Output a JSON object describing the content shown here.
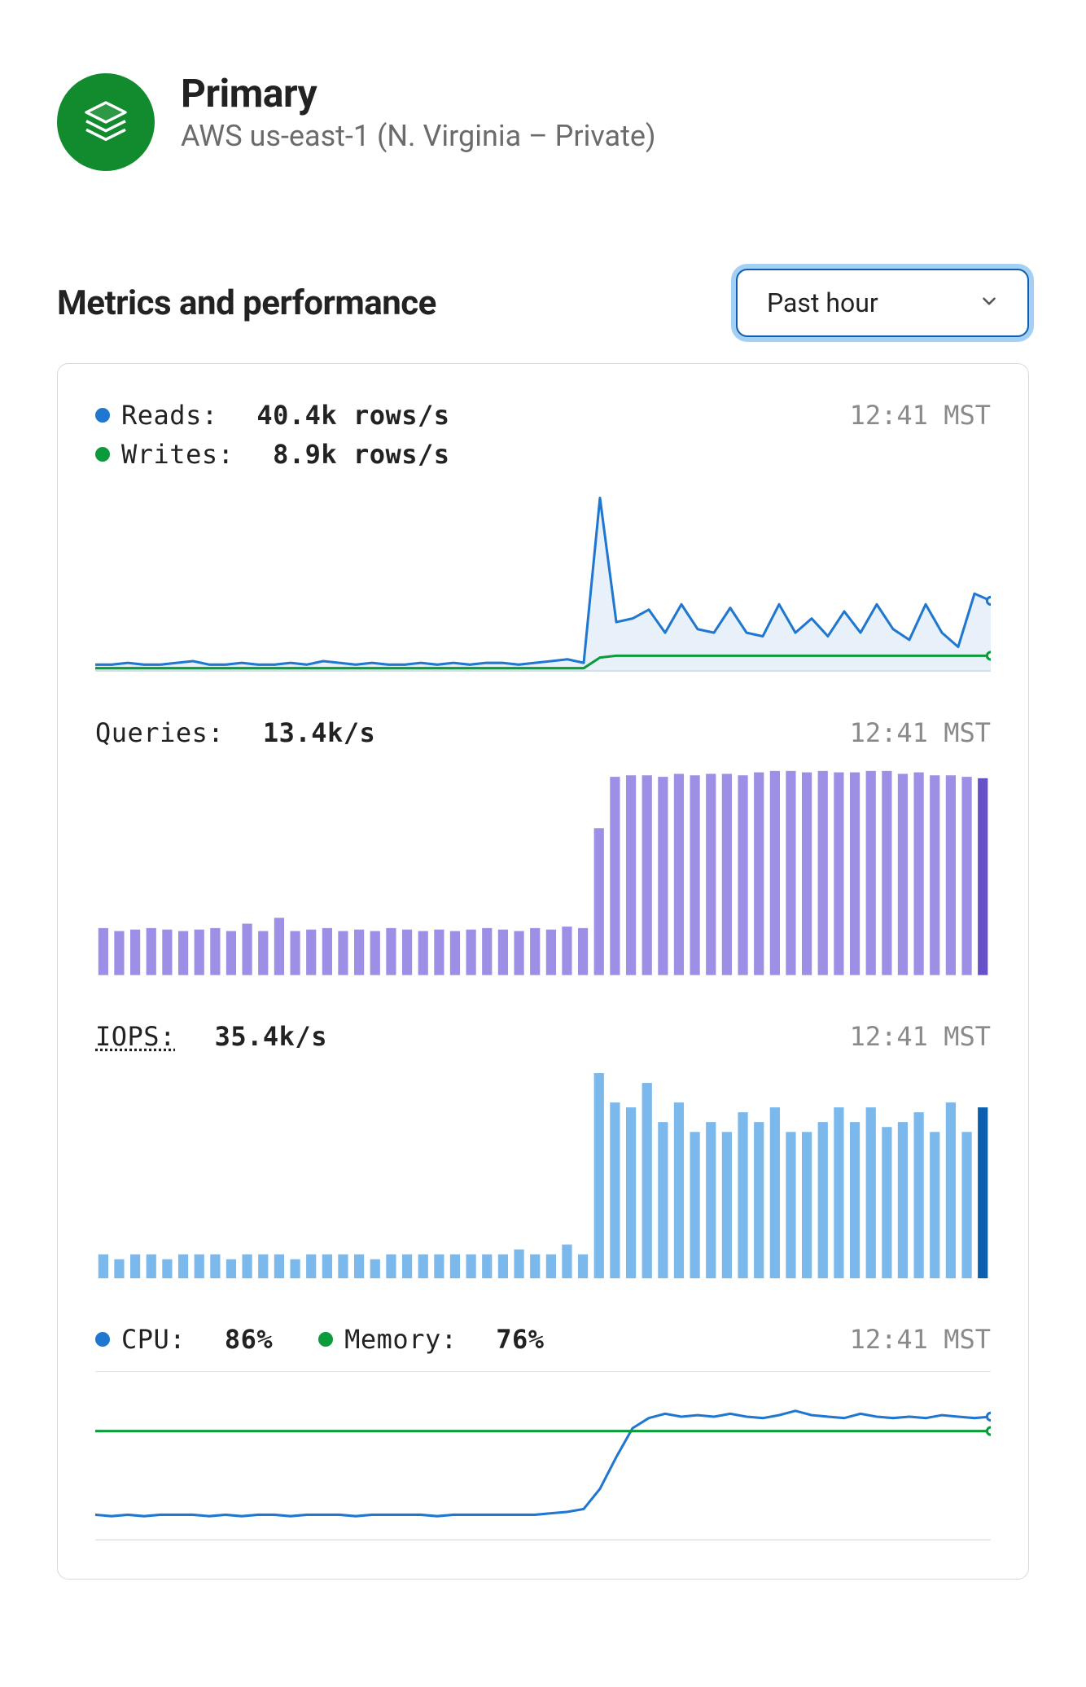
{
  "header": {
    "title": "Primary",
    "subtitle": "AWS us-east-1 (N. Virginia – Private)"
  },
  "section": {
    "title": "Metrics and performance",
    "range_selected": "Past hour"
  },
  "colors": {
    "blue": "#1F77D0",
    "green": "#0B9B3B",
    "purple": "#9E8FE6",
    "purple_dark": "#6651C9",
    "light_blue": "#7BB8EC",
    "blue_dark": "#0B5FAE"
  },
  "plots": {
    "rw": {
      "timestamp": "12:41 MST",
      "reads": {
        "label": "Reads:",
        "value": "40.4k rows/s"
      },
      "writes": {
        "label": "Writes:",
        "value": "8.9k rows/s"
      }
    },
    "queries": {
      "timestamp": "12:41 MST",
      "label": "Queries:",
      "value": "13.4k/s"
    },
    "iops": {
      "timestamp": "12:41 MST",
      "label": "IOPS:",
      "value": "35.4k/s"
    },
    "cpu_mem": {
      "timestamp": "12:41 MST",
      "cpu": {
        "label": "CPU:",
        "value": "86%"
      },
      "memory": {
        "label": "Memory:",
        "value": "76%"
      }
    }
  },
  "chart_data": [
    {
      "type": "line",
      "name": "reads_writes",
      "x_range_minutes": [
        0,
        60
      ],
      "series": [
        {
          "name": "Reads (k rows/s)",
          "values": [
            4,
            4,
            5,
            4,
            4,
            5,
            6,
            4,
            4,
            5,
            4,
            4,
            5,
            4,
            6,
            5,
            4,
            5,
            4,
            4,
            5,
            4,
            5,
            4,
            5,
            5,
            4,
            5,
            6,
            7,
            5,
            98,
            28,
            30,
            35,
            22,
            38,
            24,
            22,
            36,
            22,
            20,
            38,
            22,
            30,
            20,
            34,
            22,
            38,
            24,
            18,
            38,
            22,
            14,
            44,
            40
          ]
        },
        {
          "name": "Writes (k rows/s)",
          "values": [
            2,
            2,
            2,
            2,
            2,
            2,
            2,
            2,
            2,
            2,
            2,
            2,
            2,
            2,
            2,
            2,
            2,
            2,
            2,
            2,
            2,
            2,
            2,
            2,
            2,
            2,
            2,
            2,
            2,
            2,
            2,
            8,
            9,
            9,
            9,
            9,
            9,
            9,
            9,
            9,
            9,
            9,
            9,
            9,
            9,
            9,
            9,
            9,
            9,
            9,
            9,
            9,
            9,
            9,
            9,
            9
          ]
        }
      ],
      "ylim": [
        0,
        100
      ]
    },
    {
      "type": "bar",
      "name": "queries",
      "x_range_minutes": [
        0,
        60
      ],
      "values_ks": [
        3.2,
        3.0,
        3.1,
        3.2,
        3.1,
        3.0,
        3.1,
        3.2,
        3.0,
        3.5,
        3.0,
        3.9,
        3.0,
        3.1,
        3.2,
        3.0,
        3.1,
        3.0,
        3.2,
        3.1,
        3.0,
        3.1,
        3.0,
        3.1,
        3.2,
        3.1,
        3.0,
        3.2,
        3.1,
        3.3,
        3.2,
        10.0,
        13.5,
        13.6,
        13.6,
        13.5,
        13.7,
        13.6,
        13.7,
        13.7,
        13.6,
        13.8,
        13.9,
        13.9,
        13.8,
        13.9,
        13.8,
        13.8,
        13.9,
        13.9,
        13.7,
        13.8,
        13.6,
        13.6,
        13.5,
        13.4
      ],
      "ylim": [
        0,
        14
      ]
    },
    {
      "type": "bar",
      "name": "iops",
      "x_range_minutes": [
        0,
        60
      ],
      "values_ks": [
        5,
        4,
        5,
        5,
        4,
        5,
        5,
        5,
        4,
        5,
        5,
        5,
        4,
        5,
        5,
        5,
        5,
        4,
        5,
        5,
        5,
        5,
        5,
        5,
        5,
        5,
        6,
        5,
        5,
        7,
        5,
        42,
        36,
        35,
        40,
        32,
        36,
        30,
        32,
        30,
        34,
        32,
        35,
        30,
        30,
        32,
        35,
        32,
        35,
        31,
        32,
        34,
        30,
        36,
        30,
        35
      ],
      "ylim": [
        0,
        42
      ]
    },
    {
      "type": "line",
      "name": "cpu_memory",
      "x_range_minutes": [
        0,
        60
      ],
      "series": [
        {
          "name": "CPU (%)",
          "values": [
            18,
            17,
            18,
            17,
            18,
            18,
            18,
            17,
            18,
            17,
            18,
            18,
            17,
            18,
            18,
            18,
            17,
            18,
            18,
            18,
            18,
            17,
            18,
            18,
            18,
            18,
            18,
            18,
            19,
            20,
            22,
            36,
            58,
            78,
            85,
            88,
            86,
            87,
            86,
            88,
            86,
            85,
            87,
            90,
            87,
            86,
            85,
            88,
            86,
            85,
            86,
            85,
            87,
            86,
            85,
            86
          ]
        },
        {
          "name": "Memory (%)",
          "values": [
            76,
            76,
            76,
            76,
            76,
            76,
            76,
            76,
            76,
            76,
            76,
            76,
            76,
            76,
            76,
            76,
            76,
            76,
            76,
            76,
            76,
            76,
            76,
            76,
            76,
            76,
            76,
            76,
            76,
            76,
            76,
            76,
            76,
            76,
            76,
            76,
            76,
            76,
            76,
            76,
            76,
            76,
            76,
            76,
            76,
            76,
            76,
            76,
            76,
            76,
            76,
            76,
            76,
            76,
            76,
            76
          ]
        }
      ],
      "ylim": [
        0,
        100
      ]
    }
  ]
}
